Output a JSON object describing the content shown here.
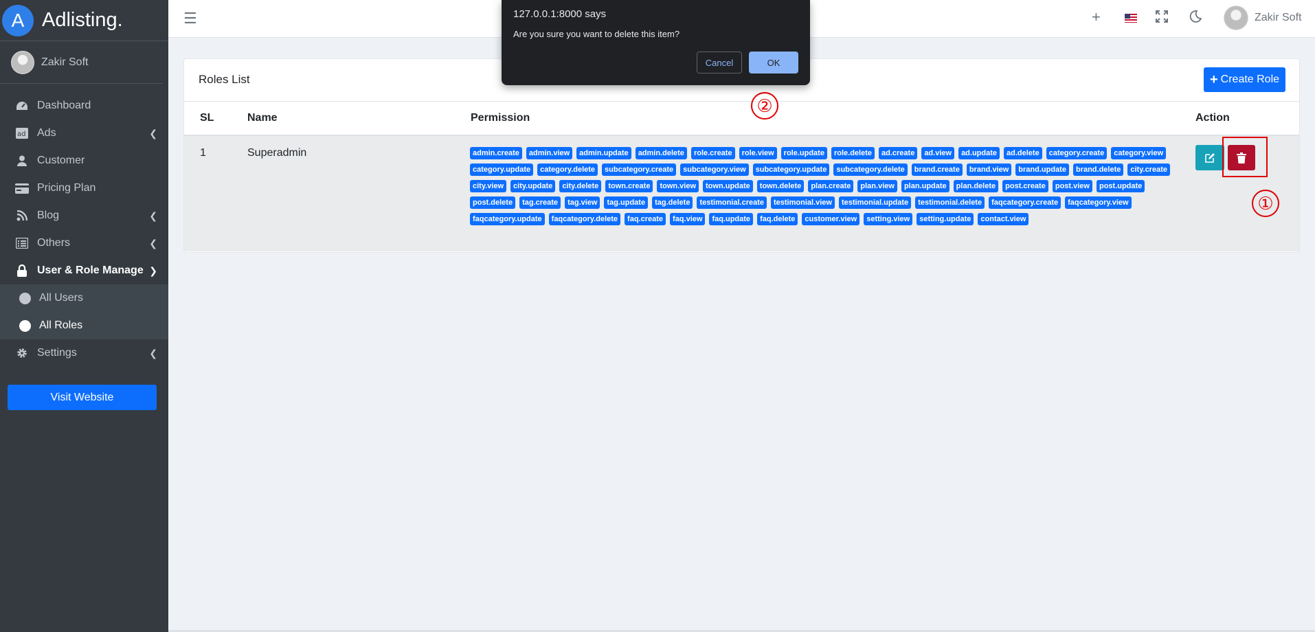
{
  "brand": {
    "logo_letter": "A",
    "name": "Adlisting."
  },
  "sidebar": {
    "user_name": "Zakir Soft",
    "items": [
      {
        "label": "Dashboard",
        "icon": "dashboard-icon",
        "caret": false
      },
      {
        "label": "Ads",
        "icon": "ads-icon",
        "caret": true
      },
      {
        "label": "Customer",
        "icon": "user-icon",
        "caret": false
      },
      {
        "label": "Pricing Plan",
        "icon": "credit-card-icon",
        "caret": false
      },
      {
        "label": "Blog",
        "icon": "blog-icon",
        "caret": true
      },
      {
        "label": "Others",
        "icon": "list-icon",
        "caret": true
      },
      {
        "label": "User & Role Manage",
        "icon": "lock-icon",
        "caret": true
      },
      {
        "label": "Settings",
        "icon": "gear-icon",
        "caret": true
      }
    ],
    "sub_items": [
      {
        "label": "All Users",
        "active": false
      },
      {
        "label": "All Roles",
        "active": true
      }
    ],
    "visit_button": "Visit Website"
  },
  "topbar": {
    "user_name": "Zakir Soft"
  },
  "card": {
    "title": "Roles List",
    "create_button": "Create Role",
    "columns": [
      "SL",
      "Name",
      "Permission",
      "Action"
    ],
    "rows": [
      {
        "sl": "1",
        "name": "Superadmin",
        "permissions": [
          "admin.create",
          "admin.view",
          "admin.update",
          "admin.delete",
          "role.create",
          "role.view",
          "role.update",
          "role.delete",
          "ad.create",
          "ad.view",
          "ad.update",
          "ad.delete",
          "category.create",
          "category.view",
          "category.update",
          "category.delete",
          "subcategory.create",
          "subcategory.view",
          "subcategory.update",
          "subcategory.delete",
          "brand.create",
          "brand.view",
          "brand.update",
          "brand.delete",
          "city.create",
          "city.view",
          "city.update",
          "city.delete",
          "town.create",
          "town.view",
          "town.update",
          "town.delete",
          "plan.create",
          "plan.view",
          "plan.update",
          "plan.delete",
          "post.create",
          "post.view",
          "post.update",
          "post.delete",
          "tag.create",
          "tag.view",
          "tag.update",
          "tag.delete",
          "testimonial.create",
          "testimonial.view",
          "testimonial.update",
          "testimonial.delete",
          "faqcategory.create",
          "faqcategory.view",
          "faqcategory.update",
          "faqcategory.delete",
          "faq.create",
          "faq.view",
          "faq.update",
          "faq.delete",
          "customer.view",
          "setting.view",
          "setting.update",
          "contact.view"
        ]
      }
    ]
  },
  "dialog": {
    "title": "127.0.0.1:8000 says",
    "message": "Are you sure you want to delete this item?",
    "cancel": "Cancel",
    "ok": "OK"
  },
  "annotations": {
    "one": "①",
    "two": "②"
  },
  "colors": {
    "sidebar_bg": "#343a40",
    "primary": "#0d6efd",
    "danger": "#b0102c",
    "info": "#17a2b8",
    "annotation": "#e00000"
  }
}
